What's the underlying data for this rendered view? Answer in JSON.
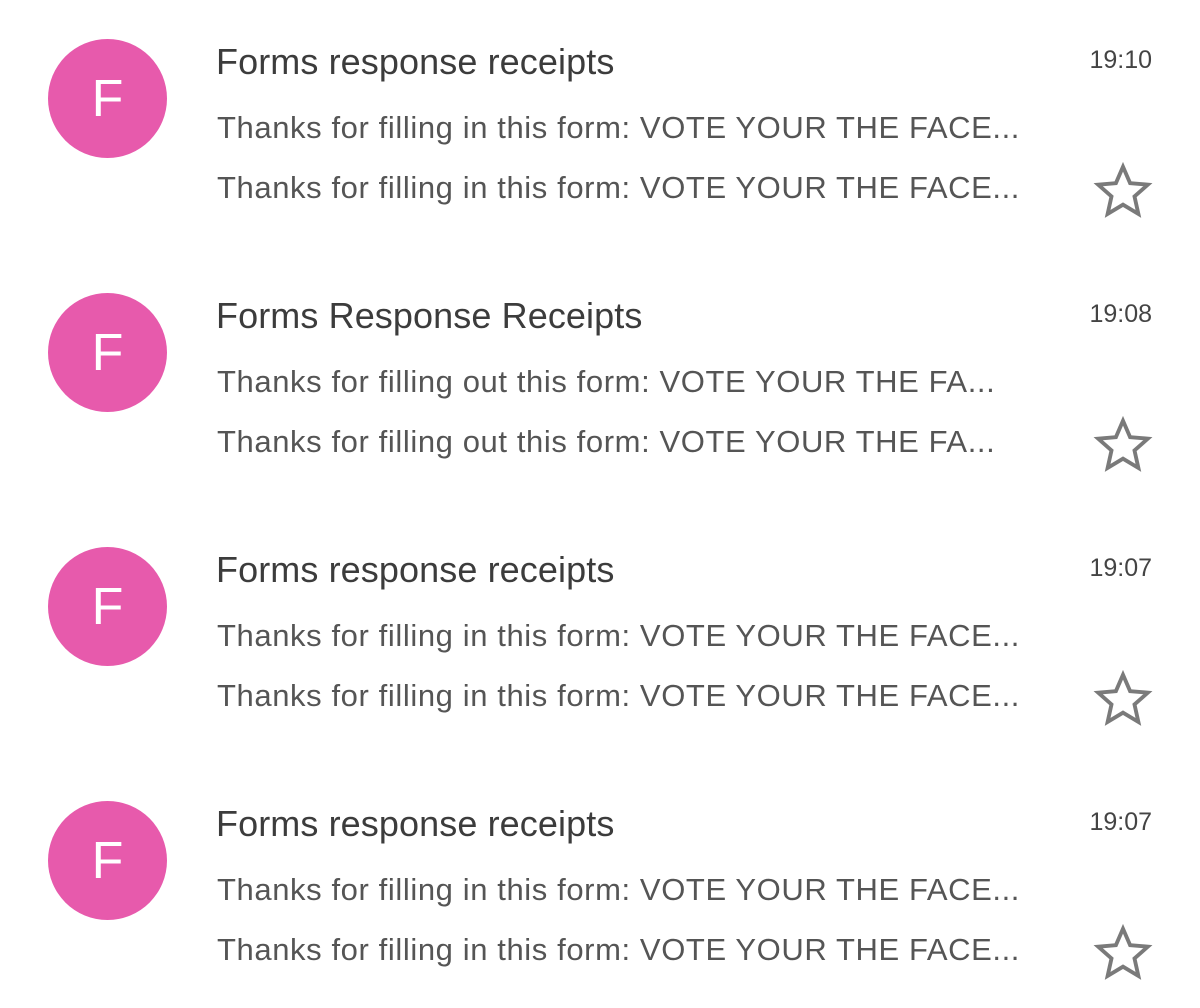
{
  "colors": {
    "avatar_bg": "#e75aac",
    "avatar_text": "#ffffff",
    "sender_text": "#3c3c3c",
    "body_text": "#555555",
    "star_outline": "#7a7a7a"
  },
  "emails": [
    {
      "avatar_letter": "F",
      "sender": "Forms response receipts",
      "time": "19:10",
      "subject": "Thanks for filling in this form: VOTE YOUR THE FACE...",
      "snippet": "Thanks for filling in this form: VOTE YOUR THE FACE...",
      "star_icon": "star-outline-icon",
      "starred": false
    },
    {
      "avatar_letter": "F",
      "sender": "Forms Response Receipts",
      "time": "19:08",
      "subject": "Thanks for filling out this form: VOTE YOUR THE FA...",
      "snippet": "Thanks for filling out this form: VOTE YOUR THE FA...",
      "star_icon": "star-outline-icon",
      "starred": false
    },
    {
      "avatar_letter": "F",
      "sender": "Forms response receipts",
      "time": "19:07",
      "subject": "Thanks for filling in this form: VOTE YOUR THE FACE...",
      "snippet": "Thanks for filling in this form: VOTE YOUR THE FACE...",
      "star_icon": "star-outline-icon",
      "starred": false
    },
    {
      "avatar_letter": "F",
      "sender": "Forms response receipts",
      "time": "19:07",
      "subject": "Thanks for filling in this form: VOTE YOUR THE FACE...",
      "snippet": "Thanks for filling in this form: VOTE YOUR THE FACE...",
      "star_icon": "star-outline-icon",
      "starred": false
    }
  ]
}
